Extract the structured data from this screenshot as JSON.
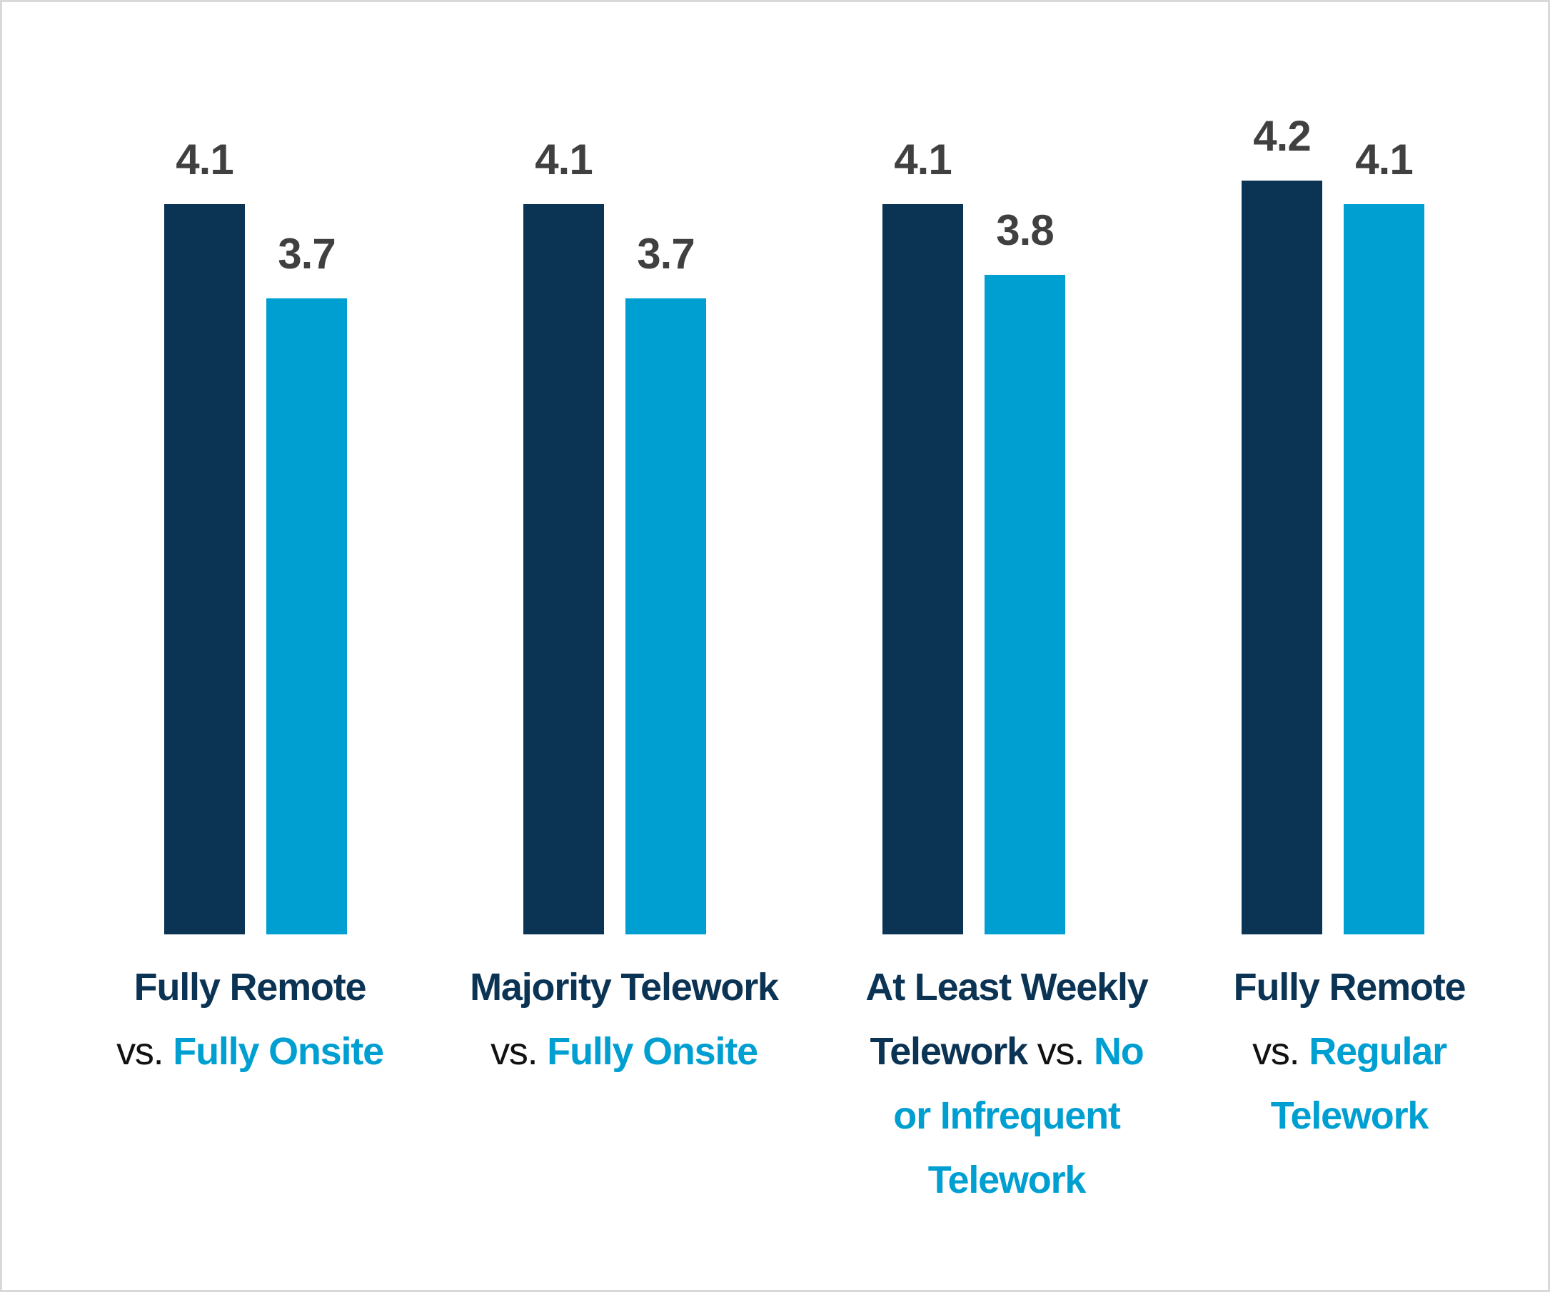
{
  "chart_data": {
    "type": "bar",
    "title": "",
    "xlabel": "",
    "ylabel": "",
    "ylim": [
      1,
      4.3
    ],
    "grid": false,
    "legend": "none",
    "categories": [
      {
        "primary": "Fully Remote",
        "connector": "vs.",
        "comparison": "Fully Onsite"
      },
      {
        "primary": "Majority Telework",
        "connector": "vs.",
        "comparison": "Fully Onsite"
      },
      {
        "primary": "At Least Weekly Telework",
        "connector": "vs.",
        "comparison": "No or Infrequent Telework"
      },
      {
        "primary": "Fully Remote",
        "connector": "vs.",
        "comparison": "Regular Telework"
      }
    ],
    "series": [
      {
        "name": "primary group",
        "color": "#0b3354",
        "values": [
          4.1,
          4.1,
          4.1,
          4.2
        ],
        "labels": [
          "4.1",
          "4.1",
          "4.1",
          "4.2"
        ]
      },
      {
        "name": "comparison group",
        "color": "#009fd1",
        "values": [
          3.7,
          3.7,
          3.8,
          4.1
        ],
        "labels": [
          "3.7",
          "3.7",
          "3.8",
          "4.1"
        ]
      }
    ]
  },
  "labels": {
    "g0": {
      "l1a": "Fully Remote",
      "l2vs": "vs.",
      "l2b": "Fully Onsite"
    },
    "g1": {
      "l1a": "Majority Telework",
      "l2vs": "vs.",
      "l2b": "Fully Onsite"
    },
    "g2": {
      "l1a": "At Least Weekly",
      "l2a": "Telework",
      "l2vs": "vs.",
      "l2b": "No",
      "l3b": "or Infrequent",
      "l4b": "Telework"
    },
    "g3": {
      "l1a": "Fully Remote",
      "l2vs": "vs.",
      "l2b": "Regular",
      "l3b": "Telework"
    }
  },
  "colors": {
    "primary": "#0b3354",
    "comparison": "#009fd1",
    "value_label": "#404040",
    "border": "#d9d9d9"
  }
}
